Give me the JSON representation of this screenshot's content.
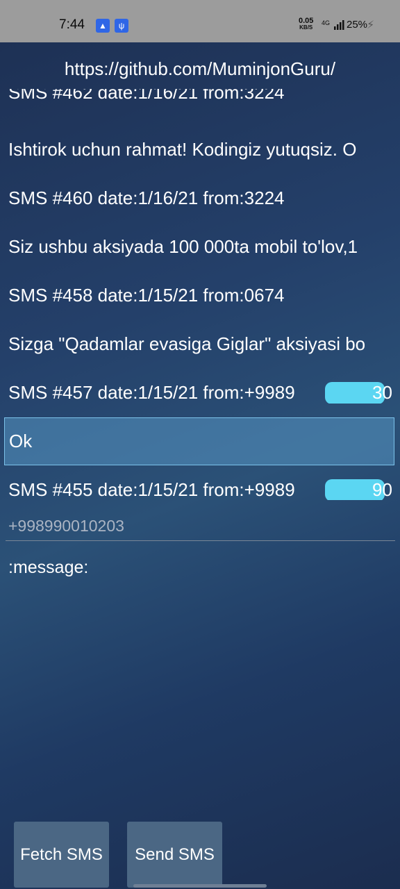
{
  "statusbar": {
    "time": "7:44",
    "icons": [
      "android-debug-icon",
      "usb-icon"
    ],
    "speed_value": "0.05",
    "speed_unit": "KB/S",
    "network": "4G",
    "battery": "25%"
  },
  "header": {
    "url": "https://github.com/MuminjonGuru/"
  },
  "sms_list": {
    "items": [
      "SMS #462 date:1/16/21 from:3224",
      "Ishtirok uchun rahmat! Kodingiz yutuqsiz. O",
      "SMS #460 date:1/16/21 from:3224",
      "Siz ushbu aksiyada 100 000ta mobil to'lov,1",
      "SMS #458 date:1/15/21 from:0674",
      "Sizga \"Qadamlar evasiga Giglar\" aksiyasi bo",
      "SMS #457 date:1/15/21 from:+9989",
      "Ok",
      "SMS #455 date:1/15/21 from:+9989"
    ],
    "tail_457": "30",
    "tail_455": "90"
  },
  "form": {
    "phone_placeholder": "+998990010203",
    "message_placeholder": ":message:"
  },
  "buttons": {
    "fetch": "Fetch SMS",
    "send": "Send SMS"
  },
  "colors": {
    "accent_selection": "#7cc2ea",
    "redaction": "#5bd6f2"
  }
}
